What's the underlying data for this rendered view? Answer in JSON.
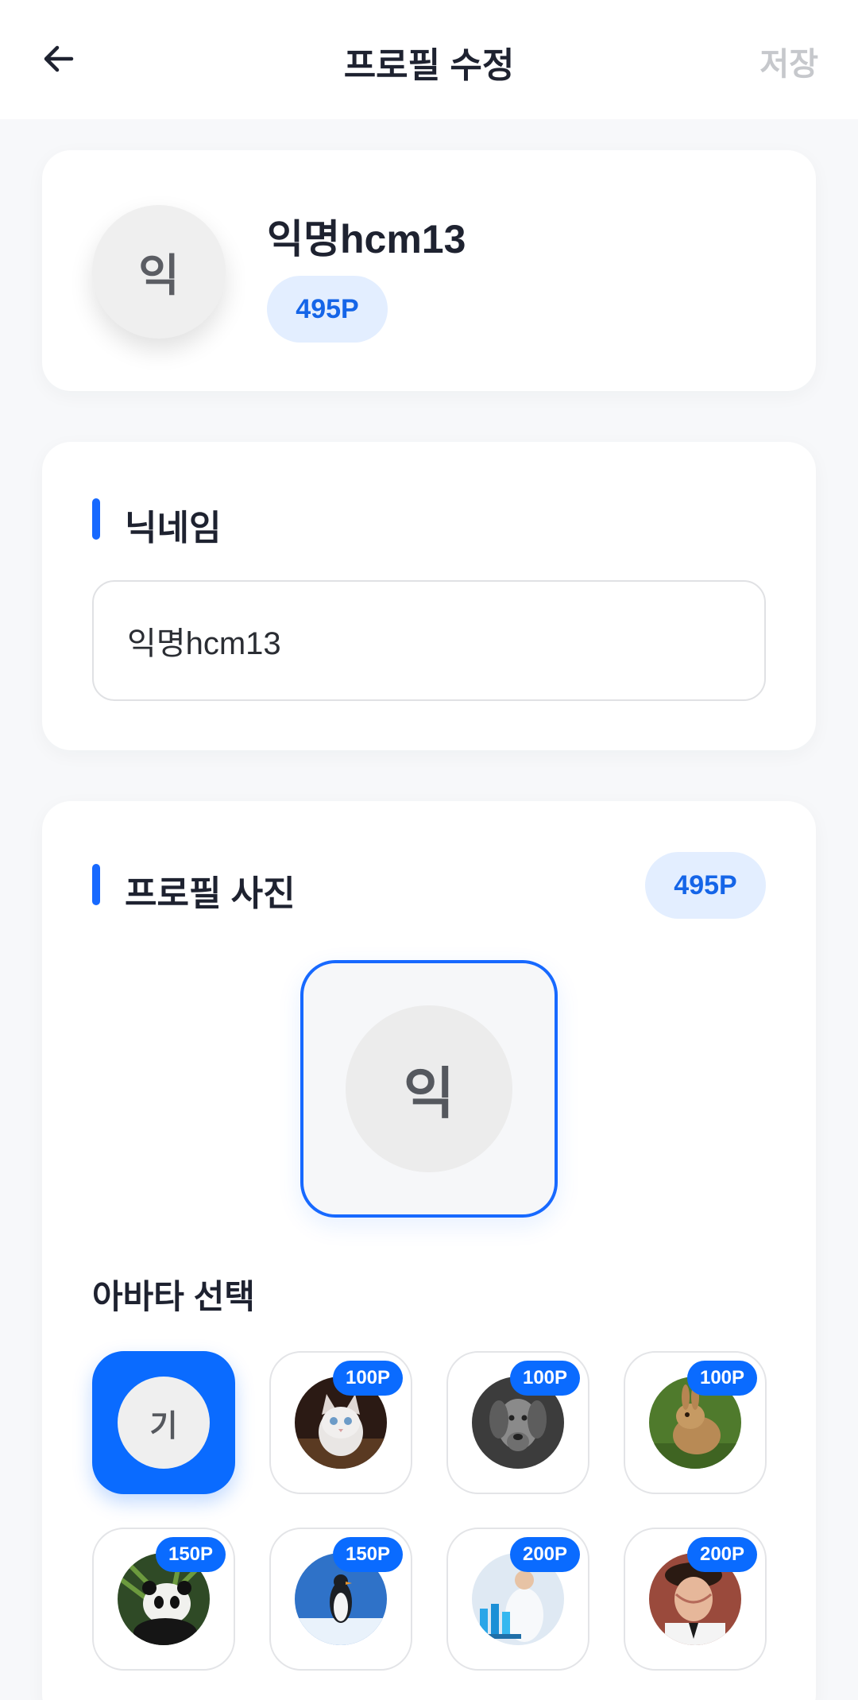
{
  "header": {
    "title": "프로필 수정",
    "save_label": "저장"
  },
  "profile": {
    "avatar_letter": "익",
    "name": "익명hcm13",
    "points": "495P"
  },
  "nickname": {
    "section_title": "닉네임",
    "value": "익명hcm13"
  },
  "photo": {
    "section_title": "프로필 사진",
    "points": "495P",
    "preview_letter": "익",
    "avatar_heading": "아바타 선택",
    "avatars": [
      {
        "kind": "letter",
        "letter": "기",
        "price": "",
        "selected": true
      },
      {
        "kind": "cat",
        "price": "100P"
      },
      {
        "kind": "dog",
        "price": "100P"
      },
      {
        "kind": "rabbit",
        "price": "100P"
      },
      {
        "kind": "panda",
        "price": "150P"
      },
      {
        "kind": "penguin",
        "price": "150P"
      },
      {
        "kind": "scientist",
        "price": "200P"
      },
      {
        "kind": "officer",
        "price": "200P"
      }
    ]
  },
  "colors": {
    "accent": "#0a6bff",
    "badge_bg": "#e3eeff",
    "muted": "#c6c8cc"
  }
}
